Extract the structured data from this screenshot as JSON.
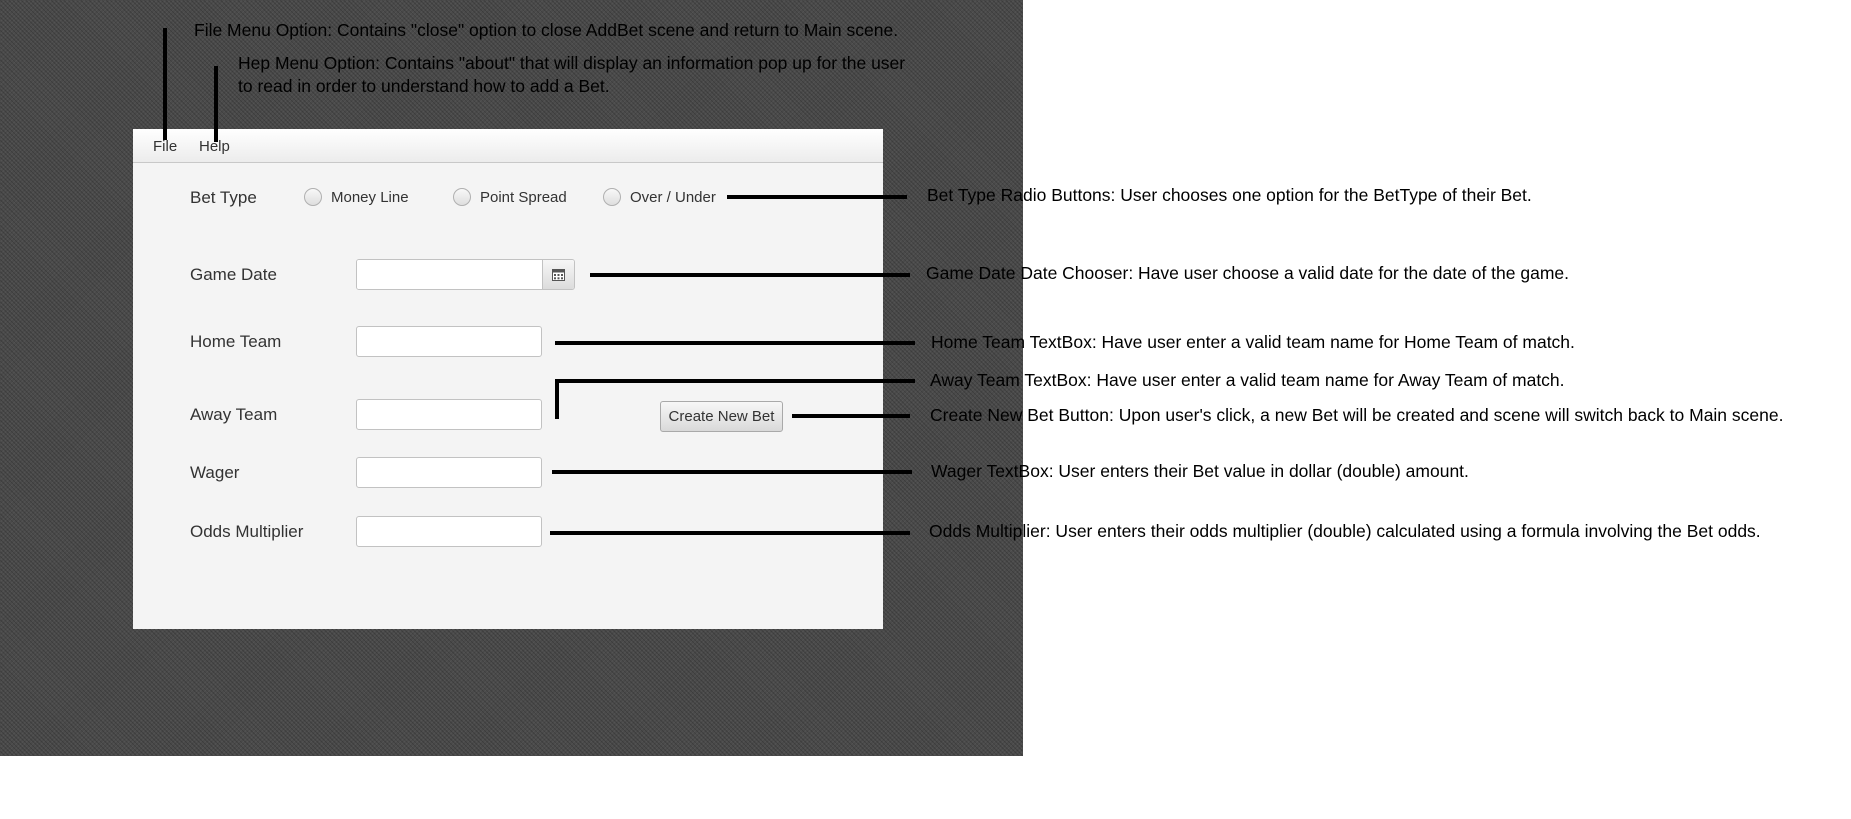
{
  "menu": {
    "file": "File",
    "help": "Help"
  },
  "form": {
    "bet_type_label": "Bet Type",
    "bet_type_options": [
      "Money Line",
      "Point Spread",
      "Over / Under"
    ],
    "game_date_label": "Game Date",
    "game_date_value": "",
    "home_team_label": "Home Team",
    "home_team_value": "",
    "away_team_label": "Away Team",
    "away_team_value": "",
    "wager_label": "Wager",
    "wager_value": "",
    "odds_label": "Odds Multiplier",
    "odds_value": "",
    "create_button": "Create New Bet"
  },
  "annotations": {
    "file_menu": "File Menu Option: Contains \"close\" option to close AddBet scene and return to Main scene.",
    "help_menu": "Hep Menu Option: Contains \"about\" that will display an information pop up for the user to read in order to understand how to add a Bet.",
    "bet_type": "Bet Type Radio Buttons: User chooses one option for the BetType of their Bet.",
    "game_date": "Game Date Date Chooser: Have user choose a valid date for the date of the game.",
    "home_team": "Home Team TextBox: Have user enter a valid team name for Home Team of match.",
    "away_team": "Away Team TextBox: Have user enter a valid team name for Away Team of match.",
    "create_bet": "Create New Bet Button: Upon user's click, a new Bet will be created and scene will switch back to Main scene.",
    "wager": "Wager TextBox: User enters their Bet value in dollar (double) amount.",
    "odds": "Odds Multiplier: User enters their odds multiplier (double) calculated using a formula involving the Bet odds."
  },
  "icons": {
    "calendar": "calendar-icon"
  }
}
